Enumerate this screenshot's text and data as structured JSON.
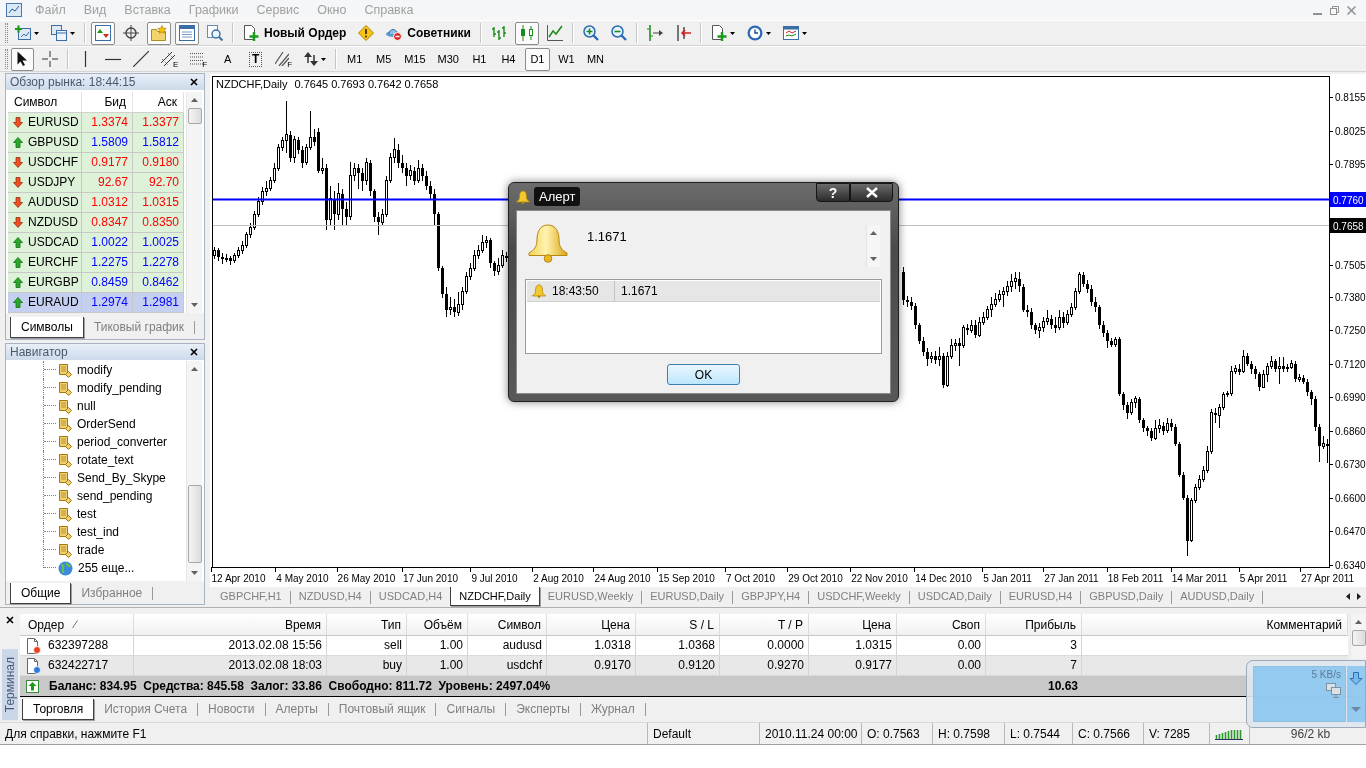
{
  "window": {
    "menu": [
      "Файл",
      "Вид",
      "Вставка",
      "Графики",
      "Сервис",
      "Окно",
      "Справка"
    ]
  },
  "toolbar_main": {
    "groups": [
      {
        "items": [
          {
            "dropdown": true,
            "pressed": false
          },
          {
            "dropdown": true,
            "pressed": false
          }
        ]
      },
      {
        "items": [
          {
            "pressed": true
          },
          {
            "pressed": false
          },
          {
            "pressed": true
          },
          {
            "pressed": true
          },
          {
            "pressed": false
          }
        ]
      },
      {
        "items": [
          {
            "label": "Новый Ордер",
            "pressed": false
          },
          {
            "pressed": false
          },
          {
            "label": "Советники",
            "pressed": false
          }
        ]
      },
      {
        "items": [
          {
            "pressed": false
          },
          {
            "pressed": true
          },
          {
            "pressed": false
          }
        ]
      },
      {
        "items": [
          {
            "pressed": false
          },
          {
            "pressed": false
          }
        ]
      },
      {
        "items": [
          {
            "pressed": false
          },
          {
            "pressed": false
          }
        ]
      },
      {
        "items": [
          {
            "dropdown": true,
            "pressed": false
          },
          {
            "dropdown": true,
            "pressed": false
          },
          {
            "dropdown": true,
            "pressed": false
          }
        ]
      }
    ]
  },
  "toolbar_drawing": {
    "groups": [
      {
        "items": [
          {
            "kind": "icon",
            "pressed": true
          },
          {
            "kind": "icon",
            "pressed": false
          }
        ]
      },
      {
        "items": [
          {
            "kind": "icon",
            "pressed": false
          },
          {
            "kind": "icon",
            "pressed": false
          },
          {
            "kind": "icon",
            "pressed": false
          },
          {
            "kind": "icon",
            "sub": "E",
            "pressed": false
          },
          {
            "kind": "icon",
            "sub": "F",
            "pressed": false
          },
          {
            "kind": "text",
            "label": "A",
            "pressed": false
          },
          {
            "kind": "framed_text",
            "label": "T",
            "pressed": false
          },
          {
            "kind": "icon",
            "sub": "F",
            "pressed": false
          },
          {
            "kind": "icon",
            "dropdown": true,
            "pressed": false
          }
        ]
      },
      {
        "items": [
          {
            "kind": "text",
            "label": "M1",
            "pressed": false
          },
          {
            "kind": "text",
            "label": "M5",
            "pressed": false
          },
          {
            "kind": "text",
            "label": "M15",
            "pressed": false
          },
          {
            "kind": "text",
            "label": "M30",
            "pressed": false
          },
          {
            "kind": "text",
            "label": "H1",
            "pressed": false
          },
          {
            "kind": "text",
            "label": "H4",
            "pressed": false
          },
          {
            "kind": "text",
            "label": "D1",
            "pressed": true
          },
          {
            "kind": "text",
            "label": "W1",
            "pressed": false
          },
          {
            "kind": "text",
            "label": "MN",
            "pressed": false
          }
        ]
      }
    ]
  },
  "market_watch": {
    "title": "Обзор рынка: 18:44:15",
    "columns": [
      "Символ",
      "Бид",
      "Аск"
    ],
    "rows": [
      {
        "symbol": "EURUSD",
        "bid": "1.3374",
        "ask": "1.3377",
        "rising": false,
        "selected": false
      },
      {
        "symbol": "GBPUSD",
        "bid": "1.5809",
        "ask": "1.5812",
        "rising": true,
        "selected": false
      },
      {
        "symbol": "USDCHF",
        "bid": "0.9177",
        "ask": "0.9180",
        "rising": false,
        "selected": false
      },
      {
        "symbol": "USDJPY",
        "bid": "92.67",
        "ask": "92.70",
        "rising": false,
        "selected": false
      },
      {
        "symbol": "AUDUSD",
        "bid": "1.0312",
        "ask": "1.0315",
        "rising": false,
        "selected": false
      },
      {
        "symbol": "NZDUSD",
        "bid": "0.8347",
        "ask": "0.8350",
        "rising": false,
        "selected": false
      },
      {
        "symbol": "USDCAD",
        "bid": "1.0022",
        "ask": "1.0025",
        "rising": true,
        "selected": false
      },
      {
        "symbol": "EURCHF",
        "bid": "1.2275",
        "ask": "1.2278",
        "rising": true,
        "selected": false
      },
      {
        "symbol": "EURGBP",
        "bid": "0.8459",
        "ask": "0.8462",
        "rising": true,
        "selected": false
      },
      {
        "symbol": "EURAUD",
        "bid": "1.2974",
        "ask": "1.2981",
        "rising": true,
        "selected": true
      }
    ],
    "tabs": [
      {
        "label": "Символы",
        "selected": true
      },
      {
        "label": "Тиковый график",
        "selected": false
      }
    ]
  },
  "navigator": {
    "title": "Навигатор",
    "items": [
      {
        "kind": "script",
        "label": "modify"
      },
      {
        "kind": "script",
        "label": "modify_pending"
      },
      {
        "kind": "script",
        "label": "null"
      },
      {
        "kind": "script",
        "label": "OrderSend"
      },
      {
        "kind": "script",
        "label": "period_converter"
      },
      {
        "kind": "script",
        "label": "rotate_text"
      },
      {
        "kind": "script",
        "label": "Send_By_Skype"
      },
      {
        "kind": "script",
        "label": "send_pending"
      },
      {
        "kind": "script",
        "label": "test"
      },
      {
        "kind": "script",
        "label": "test_ind"
      },
      {
        "kind": "script",
        "label": "trade"
      },
      {
        "kind": "more",
        "label": "255 еще..."
      }
    ],
    "tabs": [
      {
        "label": "Общие",
        "selected": true
      },
      {
        "label": "Избранное",
        "selected": false
      }
    ]
  },
  "chart": {
    "symbol": "NZDCHF,Daily",
    "ohlc": "0.7645 0.7693 0.7642 0.7658",
    "chart_data": {
      "type": "candlestick",
      "ylim": [
        0.6331,
        0.8237
      ],
      "categories": [
        null,
        null,
        null,
        null,
        null,
        null,
        "12 Apr 2010",
        null,
        null,
        null,
        null,
        null,
        null,
        null,
        null,
        null,
        null,
        null,
        null,
        null,
        null,
        null,
        "4 May 2010",
        null,
        null,
        null,
        null,
        null,
        null,
        null,
        null,
        null,
        null,
        null,
        null,
        null,
        null,
        null,
        "26 May 2010",
        null,
        null,
        null,
        null,
        null,
        null,
        null,
        null,
        null,
        null,
        null,
        null,
        null,
        null,
        null,
        "17 Jun 2010",
        null,
        null,
        null,
        null,
        null,
        null,
        null,
        null,
        null,
        null,
        null,
        null,
        null,
        null,
        null,
        "9 Jul 2010",
        null,
        null,
        null,
        null,
        null,
        null,
        null,
        null,
        null,
        null,
        null,
        null,
        null,
        null,
        null,
        "2 Aug 2010",
        null,
        null,
        null,
        null,
        null,
        null,
        null,
        null,
        null,
        null,
        null,
        null,
        null,
        null,
        null,
        "24 Aug 2010",
        null,
        null,
        null,
        null,
        null,
        null,
        null,
        null,
        null,
        null,
        null,
        null,
        null,
        null,
        null,
        "15 Sep 2010",
        null,
        null,
        null,
        null,
        null,
        null,
        null,
        null,
        null,
        null,
        null,
        null,
        null,
        null,
        null,
        "7 Oct 2010",
        null,
        null,
        null,
        null,
        null,
        null,
        null,
        null,
        null,
        null,
        null,
        null,
        null,
        null,
        null,
        "29 Oct 2010",
        null,
        null,
        null,
        null,
        null,
        null,
        null,
        null,
        null,
        null,
        null,
        null,
        null,
        null,
        null,
        "22 Nov 2010",
        null,
        null,
        null,
        null,
        null,
        null,
        null,
        null,
        null,
        null,
        null,
        null,
        null,
        null,
        null,
        "14 Dec 2010",
        null,
        null,
        null,
        null,
        null,
        null,
        null,
        null,
        null,
        null,
        null,
        null,
        null,
        null,
        null,
        "5 Jan 2011",
        null,
        null,
        null,
        null,
        null,
        null,
        null,
        null,
        null,
        null,
        null,
        null,
        null,
        null,
        null,
        "27 Jan 2011",
        null,
        null,
        null,
        null,
        null,
        null,
        null,
        null,
        null,
        null,
        null,
        null,
        null,
        null,
        null,
        "18 Feb 2011",
        null,
        null,
        null,
        null,
        null,
        null,
        null,
        null,
        null,
        null,
        null,
        null,
        null,
        null,
        null,
        "14 Mar 2011",
        null,
        null,
        null,
        null,
        null,
        null,
        null,
        null,
        null,
        null,
        null,
        null,
        null,
        null,
        null,
        "5 Apr 2011",
        null,
        null,
        null,
        null,
        null,
        null,
        null,
        null,
        null,
        null,
        null,
        null,
        null,
        null,
        null,
        "27 Apr 2011"
      ],
      "ohlc": [
        [
          0.754,
          0.7575,
          0.7528,
          0.756
        ],
        [
          0.756,
          0.7568,
          0.752,
          0.7535
        ],
        [
          0.7535,
          0.755,
          0.7508,
          0.7525
        ],
        [
          0.7525,
          0.7545,
          0.7515,
          0.753
        ],
        [
          0.753,
          0.754,
          0.7505,
          0.752
        ],
        [
          0.752,
          0.7552,
          0.7512,
          0.754
        ],
        [
          0.754,
          0.7572,
          0.753,
          0.756
        ],
        [
          0.756,
          0.7595,
          0.7548,
          0.758
        ],
        [
          0.758,
          0.7632,
          0.757,
          0.762
        ],
        [
          0.762,
          0.7665,
          0.761,
          0.765
        ],
        [
          0.765,
          0.7712,
          0.764,
          0.77
        ],
        [
          0.77,
          0.7768,
          0.769,
          0.775
        ],
        [
          0.775,
          0.7805,
          0.7735,
          0.779
        ],
        [
          0.779,
          0.783,
          0.777,
          0.78
        ],
        [
          0.78,
          0.7845,
          0.779,
          0.783
        ],
        [
          0.783,
          0.79,
          0.782,
          0.788
        ],
        [
          0.788,
          0.7975,
          0.787,
          0.796
        ],
        [
          0.796,
          0.8,
          0.7945,
          0.7985
        ],
        [
          0.7985,
          0.8142,
          0.794,
          0.801
        ],
        [
          0.801,
          0.8025,
          0.7905,
          0.792
        ],
        [
          0.792,
          0.8005,
          0.79,
          0.799
        ],
        [
          0.799,
          0.8,
          0.7935,
          0.795
        ],
        [
          0.795,
          0.7965,
          0.788,
          0.79
        ],
        [
          0.79,
          0.7975,
          0.789,
          0.796
        ],
        [
          0.796,
          0.81,
          0.795,
          0.8
        ],
        [
          0.8,
          0.803,
          0.7965,
          0.798
        ],
        [
          0.802,
          0.8035,
          0.786,
          0.787
        ],
        [
          0.787,
          0.792,
          0.7855,
          0.788
        ],
        [
          0.788,
          0.7895,
          0.764,
          0.768
        ],
        [
          0.768,
          0.781,
          0.766,
          0.776
        ],
        [
          0.776,
          0.779,
          0.764,
          0.77
        ],
        [
          0.77,
          0.782,
          0.768,
          0.778
        ],
        [
          0.778,
          0.78,
          0.766,
          0.772
        ],
        [
          0.772,
          0.775,
          0.766,
          0.769
        ],
        [
          0.769,
          0.7905,
          0.768,
          0.785
        ],
        [
          0.785,
          0.79,
          0.783,
          0.788
        ],
        [
          0.788,
          0.7895,
          0.78,
          0.786
        ],
        [
          0.786,
          0.788,
          0.779,
          0.783
        ],
        [
          0.783,
          0.792,
          0.7815,
          0.79
        ],
        [
          0.79,
          0.791,
          0.777,
          0.779
        ],
        [
          0.779,
          0.78,
          0.767,
          0.769
        ],
        [
          0.769,
          0.771,
          0.762,
          0.767
        ],
        [
          0.767,
          0.772,
          0.7655,
          0.77
        ],
        [
          0.77,
          0.785,
          0.769,
          0.783
        ],
        [
          0.783,
          0.794,
          0.782,
          0.792
        ],
        [
          0.792,
          0.7995,
          0.79,
          0.795
        ],
        [
          0.795,
          0.7975,
          0.788,
          0.79
        ],
        [
          0.79,
          0.793,
          0.786,
          0.788
        ],
        [
          0.788,
          0.79,
          0.781,
          0.785
        ],
        [
          0.785,
          0.789,
          0.7835,
          0.787
        ],
        [
          0.787,
          0.7885,
          0.7815,
          0.783
        ],
        [
          0.783,
          0.791,
          0.782,
          0.788
        ],
        [
          0.788,
          0.7895,
          0.783,
          0.785
        ],
        [
          0.785,
          0.787,
          0.7795,
          0.781
        ],
        [
          0.781,
          0.783,
          0.776,
          0.778
        ],
        [
          0.778,
          0.78,
          0.766,
          0.77
        ],
        [
          0.77,
          0.771,
          0.748,
          0.749
        ],
        [
          0.749,
          0.75,
          0.7375,
          0.739
        ],
        [
          0.739,
          0.742,
          0.73,
          0.733
        ],
        [
          0.733,
          0.738,
          0.731,
          0.734
        ],
        [
          0.734,
          0.737,
          0.73,
          0.732
        ],
        [
          0.732,
          0.74,
          0.7305,
          0.735
        ],
        [
          0.735,
          0.742,
          0.733,
          0.74
        ],
        [
          0.74,
          0.7475,
          0.739,
          0.746
        ],
        [
          0.746,
          0.751,
          0.7445,
          0.749
        ],
        [
          0.749,
          0.756,
          0.748,
          0.754
        ],
        [
          0.754,
          0.758,
          0.7525,
          0.756
        ],
        [
          0.756,
          0.762,
          0.755,
          0.759
        ],
        [
          0.759,
          0.7615,
          0.757,
          0.76
        ],
        [
          0.76,
          0.761,
          0.749,
          0.751
        ],
        [
          0.751,
          0.752,
          0.746,
          0.748
        ],
        [
          0.748,
          0.753,
          0.7465,
          0.75
        ],
        [
          0.75,
          0.756,
          0.749,
          0.754
        ],
        [
          0.754,
          0.7555,
          0.7515,
          0.753
        ],
        null,
        null,
        null,
        null,
        null,
        null,
        null,
        null,
        null,
        null,
        null,
        null,
        null,
        null,
        null,
        null,
        null,
        null,
        null,
        null,
        null,
        null,
        null,
        null,
        null,
        null,
        null,
        null,
        null,
        null,
        null,
        null,
        null,
        null,
        null,
        null,
        null,
        null,
        null,
        null,
        null,
        null,
        null,
        null,
        null,
        null,
        null,
        null,
        null,
        null,
        null,
        null,
        null,
        null,
        null,
        null,
        null,
        null,
        null,
        null,
        null,
        null,
        null,
        null,
        null,
        null,
        null,
        null,
        null,
        null,
        null,
        null,
        null,
        null,
        null,
        null,
        null,
        null,
        null,
        null,
        null,
        null,
        null,
        null,
        null,
        null,
        null,
        null,
        null,
        null,
        null,
        null,
        null,
        null,
        null,
        null,
        null,
        null,
        [
          0.7478,
          0.7495,
          0.735,
          0.7367
        ],
        [
          0.7367,
          0.7385,
          0.734,
          0.736
        ],
        [
          0.736,
          0.7378,
          0.733,
          0.7345
        ],
        [
          0.7345,
          0.7355,
          0.7255,
          0.727
        ],
        [
          0.727,
          0.728,
          0.7195,
          0.721
        ],
        [
          0.721,
          0.7225,
          0.715,
          0.7165
        ],
        [
          0.7165,
          0.718,
          0.711,
          0.714
        ],
        [
          0.714,
          0.7165,
          0.7125,
          0.715
        ],
        [
          0.715,
          0.717,
          0.712,
          0.7135
        ],
        [
          0.7135,
          0.7185,
          0.711,
          0.715
        ],
        [
          0.715,
          0.716,
          0.7025,
          0.7036
        ],
        [
          0.7036,
          0.7165,
          0.703,
          0.715
        ],
        [
          0.715,
          0.7215,
          0.714,
          0.719
        ],
        [
          0.719,
          0.7215,
          0.717,
          0.72
        ],
        [
          0.72,
          0.722,
          0.711,
          0.719
        ],
        [
          0.719,
          0.727,
          0.718,
          0.726
        ],
        [
          0.726,
          0.7275,
          0.723,
          0.725
        ],
        [
          0.725,
          0.729,
          0.724,
          0.727
        ],
        [
          0.727,
          0.729,
          0.722,
          0.723
        ],
        [
          0.723,
          0.73,
          0.7225,
          0.728
        ],
        [
          0.728,
          0.732,
          0.727,
          0.73
        ],
        [
          0.73,
          0.7345,
          0.729,
          0.733
        ],
        [
          0.733,
          0.738,
          0.73,
          0.735
        ],
        [
          0.735,
          0.7395,
          0.734,
          0.737
        ],
        [
          0.737,
          0.7405,
          0.736,
          0.739
        ],
        [
          0.739,
          0.742,
          0.734,
          0.74
        ],
        [
          0.74,
          0.744,
          0.7385,
          0.742
        ],
        [
          0.742,
          0.747,
          0.74,
          0.744
        ],
        [
          0.744,
          0.7478,
          0.741,
          0.745
        ],
        [
          0.745,
          0.7478,
          0.74,
          0.742
        ],
        [
          0.742,
          0.743,
          0.732,
          0.733
        ],
        [
          0.733,
          0.735,
          0.73,
          0.732
        ],
        [
          0.732,
          0.7335,
          0.7255,
          0.727
        ],
        [
          0.727,
          0.728,
          0.7235,
          0.725
        ],
        [
          0.725,
          0.728,
          0.722,
          0.726
        ],
        [
          0.726,
          0.73,
          0.7245,
          0.7285
        ],
        [
          0.7285,
          0.733,
          0.727,
          0.7295
        ],
        [
          0.7295,
          0.731,
          0.7255,
          0.727
        ],
        [
          0.727,
          0.73,
          0.724,
          0.726
        ],
        [
          0.726,
          0.733,
          0.725,
          0.73
        ],
        [
          0.73,
          0.732,
          0.726,
          0.728
        ],
        [
          0.728,
          0.733,
          0.727,
          0.731
        ],
        [
          0.731,
          0.7355,
          0.73,
          0.734
        ],
        [
          0.734,
          0.7415,
          0.733,
          0.74
        ],
        [
          0.74,
          0.7475,
          0.739,
          0.7465
        ],
        [
          0.7465,
          0.7478,
          0.742,
          0.743
        ],
        [
          0.743,
          0.7445,
          0.7395,
          0.741
        ],
        [
          0.741,
          0.7425,
          0.7345,
          0.736
        ],
        [
          0.736,
          0.738,
          0.732,
          0.734
        ],
        [
          0.734,
          0.735,
          0.7255,
          0.727
        ],
        [
          0.727,
          0.7285,
          0.7225,
          0.724
        ],
        [
          0.724,
          0.725,
          0.718,
          0.721
        ],
        [
          0.721,
          0.722,
          0.7185,
          0.7195
        ],
        [
          0.7195,
          0.7225,
          0.7185,
          0.7215
        ],
        [
          0.7215,
          0.7225,
          0.6995,
          0.7002
        ],
        [
          0.7002,
          0.701,
          0.694,
          0.696
        ],
        [
          0.696,
          0.697,
          0.6905,
          0.693
        ],
        [
          0.693,
          0.6985,
          0.692,
          0.697
        ],
        [
          0.697,
          0.6995,
          0.695,
          0.6985
        ],
        [
          0.6985,
          0.699,
          0.689,
          0.69
        ],
        [
          0.69,
          0.691,
          0.6855,
          0.687
        ],
        [
          0.687,
          0.688,
          0.684,
          0.686
        ],
        [
          0.686,
          0.687,
          0.682,
          0.683
        ],
        [
          0.683,
          0.69,
          0.6825,
          0.687
        ],
        [
          0.687,
          0.6905,
          0.685,
          0.688
        ],
        [
          0.688,
          0.6895,
          0.6845,
          0.686
        ],
        [
          0.686,
          0.691,
          0.685,
          0.689
        ],
        [
          0.689,
          0.6905,
          0.686,
          0.6875
        ],
        [
          0.6875,
          0.6885,
          0.68,
          0.681
        ],
        [
          0.681,
          0.6815,
          0.668,
          0.669
        ],
        [
          0.669,
          0.67,
          0.659,
          0.66
        ],
        [
          0.66,
          0.661,
          0.6374,
          0.6434
        ],
        [
          0.6434,
          0.66,
          0.643,
          0.659
        ],
        [
          0.659,
          0.6655,
          0.658,
          0.664
        ],
        [
          0.664,
          0.669,
          0.663,
          0.667
        ],
        [
          0.667,
          0.6722,
          0.666,
          0.6705
        ],
        [
          0.6705,
          0.68,
          0.6695,
          0.678
        ],
        [
          0.678,
          0.6945,
          0.677,
          0.693
        ],
        [
          0.693,
          0.695,
          0.689,
          0.692
        ],
        [
          0.692,
          0.6965,
          0.687,
          0.695
        ],
        [
          0.695,
          0.701,
          0.694,
          0.7
        ],
        [
          0.7,
          0.7015,
          0.699,
          0.7005
        ],
        [
          0.7005,
          0.711,
          0.6995,
          0.709
        ],
        [
          0.709,
          0.7115,
          0.708,
          0.71
        ],
        [
          0.71,
          0.712,
          0.7075,
          0.709
        ],
        [
          0.709,
          0.7172,
          0.7085,
          0.715
        ],
        [
          0.715,
          0.716,
          0.711,
          0.712
        ],
        [
          0.712,
          0.713,
          0.708,
          0.71
        ],
        [
          0.71,
          0.711,
          0.706,
          0.708
        ],
        [
          0.708,
          0.709,
          0.7015,
          0.703
        ],
        [
          0.703,
          0.7095,
          0.7025,
          0.708
        ],
        [
          0.708,
          0.7125,
          0.705,
          0.711
        ],
        [
          0.711,
          0.715,
          0.71,
          0.713
        ],
        [
          0.713,
          0.714,
          0.709,
          0.71
        ],
        [
          0.71,
          0.7145,
          0.704,
          0.711
        ],
        [
          0.711,
          0.7145,
          0.709,
          0.71
        ],
        [
          0.71,
          0.712,
          0.709,
          0.7105
        ],
        [
          0.7105,
          0.7135,
          0.71,
          0.712
        ],
        [
          0.712,
          0.713,
          0.705,
          0.706
        ],
        [
          0.706,
          0.708,
          0.705,
          0.7065
        ],
        [
          0.7065,
          0.7075,
          0.704,
          0.705
        ],
        [
          0.705,
          0.706,
          0.6995,
          0.701
        ],
        [
          0.701,
          0.702,
          0.696,
          0.6985
        ],
        [
          0.6985,
          0.6995,
          0.686,
          0.6875
        ],
        [
          0.6875,
          0.6885,
          0.674,
          0.68
        ],
        [
          0.68,
          0.684,
          0.679,
          0.681
        ],
        [
          0.681,
          0.683,
          0.6735,
          0.68
        ]
      ],
      "yticks": [
        {
          "value": 0.8155,
          "label": "0.8155"
        },
        {
          "value": 0.8025,
          "label": "0.8025"
        },
        {
          "value": 0.7895,
          "label": "0.7895"
        },
        {
          "value": 0.7505,
          "label": "0.7505"
        },
        {
          "value": 0.738,
          "label": "0.7380"
        },
        {
          "value": 0.725,
          "label": "0.7250"
        },
        {
          "value": 0.712,
          "label": "0.7120"
        },
        {
          "value": 0.699,
          "label": "0.6990"
        },
        {
          "value": 0.686,
          "label": "0.6860"
        },
        {
          "value": 0.673,
          "label": "0.6730"
        },
        {
          "value": 0.66,
          "label": "0.6600"
        },
        {
          "value": 0.647,
          "label": "0.6470"
        },
        {
          "value": 0.634,
          "label": "0.6340"
        }
      ],
      "ref_lines": [
        {
          "axis": "y",
          "value": 0.776,
          "label": "0.7760",
          "color": "#0000ff"
        },
        {
          "axis": "y",
          "value": 0.7658,
          "label": "0.7658",
          "color": "#c0c0c0"
        }
      ]
    }
  },
  "chart_tabs": [
    {
      "label": "GBPCHF,H1",
      "selected": false
    },
    {
      "label": "NZDUSD,H4",
      "selected": false
    },
    {
      "label": "USDCAD,H4",
      "selected": false
    },
    {
      "label": "NZDCHF,Daily",
      "selected": true
    },
    {
      "label": "EURUSD,Weekly",
      "selected": false
    },
    {
      "label": "EURUSD,Daily",
      "selected": false
    },
    {
      "label": "GBPJPY,H4",
      "selected": false
    },
    {
      "label": "USDCHF,Weekly",
      "selected": false
    },
    {
      "label": "USDCAD,Daily",
      "selected": false
    },
    {
      "label": "EURUSD,H4",
      "selected": false
    },
    {
      "label": "GBPUSD,Daily",
      "selected": false
    },
    {
      "label": "AUDUSD,Daily",
      "selected": false
    }
  ],
  "terminal": {
    "title": "Терминал",
    "columns": [
      {
        "label": "Ордер",
        "sorted": true
      },
      {
        "label": "Время",
        "sorted": false
      },
      {
        "label": "Тип",
        "sorted": false
      },
      {
        "label": "Объём",
        "sorted": false
      },
      {
        "label": "Символ",
        "sorted": false
      },
      {
        "label": "Цена",
        "sorted": false
      },
      {
        "label": "S / L",
        "sorted": false
      },
      {
        "label": "T / P",
        "sorted": false
      },
      {
        "label": "Цена",
        "sorted": false
      },
      {
        "label": "Своп",
        "sorted": false
      },
      {
        "label": "Прибыль",
        "sorted": false
      },
      {
        "label": "Комментарий",
        "sorted": false
      }
    ],
    "rows": [
      {
        "kind": "sell",
        "cells": [
          "632397288",
          "2013.02.08 15:56",
          "sell",
          "1.00",
          "audusd",
          "1.0318",
          "1.0368",
          "0.0000",
          "1.0315",
          "0.00",
          "3"
        ]
      },
      {
        "kind": "buy",
        "cells": [
          "632422717",
          "2013.02.08 18:03",
          "buy",
          "1.00",
          "usdchf",
          "0.9170",
          "0.9120",
          "0.9270",
          "0.9177",
          "0.00",
          "7"
        ]
      }
    ],
    "summary": {
      "text": "Баланс: 834.95  Средства: 845.58  Залог: 33.86  Свободно: 811.72  Уровень: 2497.04%",
      "profit": "10.63"
    },
    "tabs": [
      {
        "label": "Торговля",
        "selected": true
      },
      {
        "label": "История Счета",
        "selected": false
      },
      {
        "label": "Новости",
        "selected": false
      },
      {
        "label": "Алерты",
        "selected": false
      },
      {
        "label": "Почтовый ящик",
        "selected": false
      },
      {
        "label": "Сигналы",
        "selected": false
      },
      {
        "label": "Эксперты",
        "selected": false
      },
      {
        "label": "Журнал",
        "selected": false
      }
    ]
  },
  "status_bar": {
    "help": "Для справки, нажмите F1",
    "profile": "Default",
    "fields": [
      "2010.11.24 00:00",
      "O: 0.7563",
      "H: 0.7598",
      "L: 0.7544",
      "C: 0.7566",
      "V: 7285"
    ],
    "traffic": "96/2 kb"
  },
  "network_widget": {
    "speed": "5 KB/s"
  },
  "dialog": {
    "title": "Алерт",
    "help": "?",
    "message": "1.1671",
    "log": [
      {
        "time": "18:43:50",
        "message": "1.1671"
      }
    ],
    "button": "OK"
  }
}
